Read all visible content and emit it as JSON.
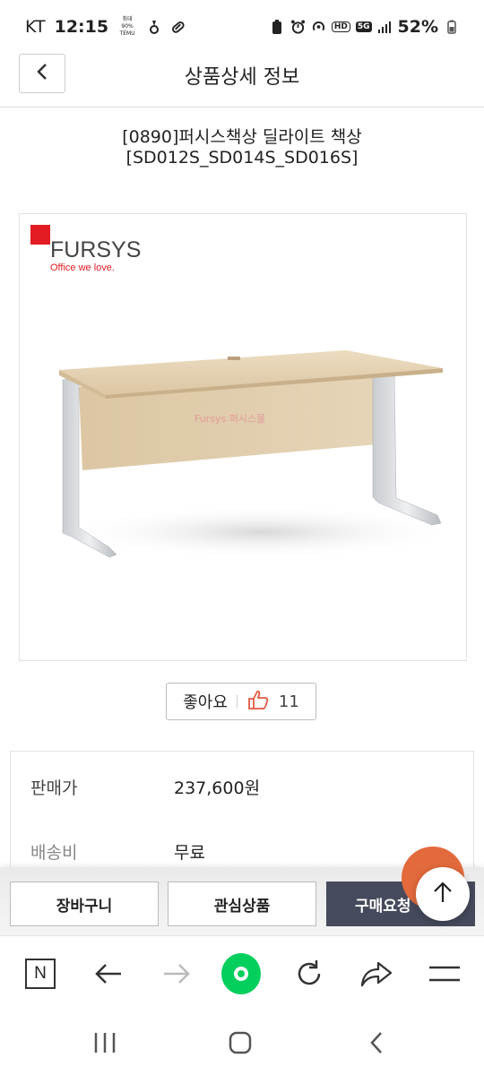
{
  "status_bar": {
    "carrier": "KT",
    "time": "12:15",
    "temu_label": "최대 90% TEMU",
    "hd": "HD",
    "network": "5G",
    "battery": "52%"
  },
  "header": {
    "title": "상품상세 정보",
    "back_icon": "chevron-left-icon"
  },
  "product": {
    "title_line1": "[0890]퍼시스책상 딜라이트 책상",
    "title_line2": "[SD012S_SD014S_SD016S]",
    "brand": "FURSYS",
    "tagline": "Office we love.",
    "watermark": "Fursys 퍼시스몰"
  },
  "like": {
    "label": "좋아요",
    "count": "11"
  },
  "price_info": {
    "price_label": "판매가",
    "price_value": "237,600원",
    "shipping_label": "배송비",
    "shipping_value": "무료"
  },
  "buy_bar": {
    "cart": "장바구니",
    "wish": "관심상품",
    "buy": "구매요청"
  },
  "browser_nav": {
    "items": [
      "n-home-icon",
      "back-arrow-icon",
      "forward-arrow-icon",
      "green-home-icon",
      "refresh-icon",
      "share-icon",
      "menu-icon"
    ]
  },
  "colors": {
    "brand_red": "#e31b23",
    "buy_button": "#454a5c",
    "naver_green": "#03cf5d",
    "fab_orange": "#e36a3c"
  }
}
